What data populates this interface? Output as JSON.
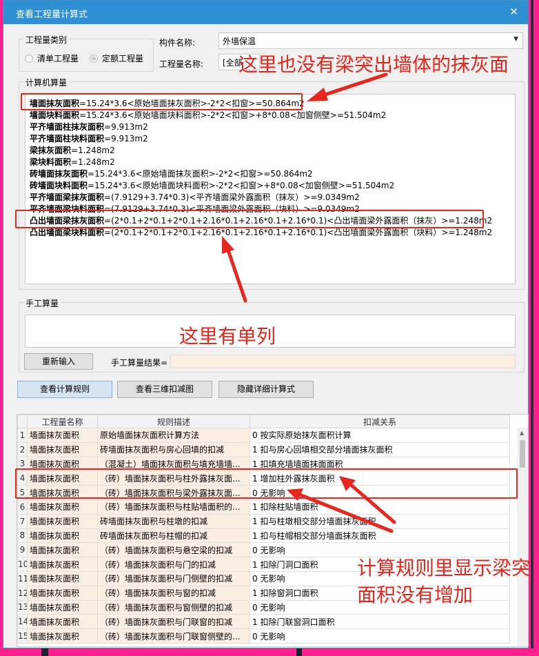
{
  "window": {
    "title": "查看工程量计算式",
    "close_glyph": "✕"
  },
  "category": {
    "legend": "工程量类别",
    "options": [
      {
        "label": "清单工程量",
        "selected": false
      },
      {
        "label": "定额工程量",
        "selected": true
      }
    ]
  },
  "component": {
    "label": "构件名称:",
    "value": "外墙保温",
    "arrow": "▼"
  },
  "quantity": {
    "label": "工程量名称:",
    "value": "[全部"
  },
  "computer": {
    "legend": "计算机算量",
    "lines": [
      {
        "name": "墙面抹灰面积",
        "formula": "=15.24*3.6<原始墙面抹灰面积>-2*2<扣窗>=50.864m2"
      },
      {
        "name": "墙面块料面积",
        "formula": "=15.24*3.6<原始墙面块料面积>-2*2<扣窗>+8*0.08<加窗侧壁>=51.504m2"
      },
      {
        "name": "平齐墙面柱抹灰面积",
        "formula": "=9.913m2"
      },
      {
        "name": "平齐墙面柱块料面积",
        "formula": "=9.913m2"
      },
      {
        "name": "梁抹灰面积",
        "formula": "=1.248m2"
      },
      {
        "name": "梁块料面积",
        "formula": "=1.248m2"
      },
      {
        "name": "砖墙面抹灰面积",
        "formula": "=15.24*3.6<原始墙面抹灰面积>-2*2<扣窗>=50.864m2"
      },
      {
        "name": "砖墙面块料面积",
        "formula": "=15.24*3.6<原始墙面块料面积>-2*2<扣窗>+8*0.08<加窗侧壁>=51.504m2"
      },
      {
        "name": "平齐墙面梁抹灰面积",
        "formula": "=(7.9129+3.74*0.3)<平齐墙面梁外露面积（抹灰）>=9.0349m2"
      },
      {
        "name": "平齐墙面梁块料面积",
        "formula": "=(7.9129+3.74*0.3)<平齐墙面梁外露面积（块料）>=9.0349m2"
      },
      {
        "name": "凸出墙面梁抹灰面积",
        "formula": "=(2*0.1+2*0.1+2*0.1+2.16*0.1+2.16*0.1+2.16*0.1)<凸出墙面梁外露面积（抹灰）>=1.248m2"
      },
      {
        "name": "凸出墙面梁块料面积",
        "formula": "=(2*0.1+2*0.1+2*0.1+2.16*0.1+2.16*0.1+2.16*0.1)<凸出墙面梁外露面积（块料）>=1.248m2"
      }
    ]
  },
  "manual": {
    "legend": "手工算量",
    "reenter_label": "重新输入",
    "result_label": "手工算量结果="
  },
  "actions": {
    "view_rules": "查看计算规则",
    "view_3d": "查看三维扣减图",
    "hide_detail": "隐藏详细计算式"
  },
  "rules_table": {
    "headers": [
      "工程量名称",
      "规则描述",
      "扣减关系"
    ],
    "rows": [
      {
        "idx": "1",
        "name": "墙面抹灰面积",
        "desc": "原始墙面抹灰面积计算方法",
        "rel": "0 按实际原始抹灰面积计算"
      },
      {
        "idx": "2",
        "name": "墙面抹灰面积",
        "desc": "砖墙面抹灰面积与房心回填的扣减",
        "rel": "1 扣与房心回填相交部分墙面抹灰面积"
      },
      {
        "idx": "3",
        "name": "墙面抹灰面积",
        "desc": "（混凝土）墙面抹灰面积与填充墙墙...",
        "rel": "1 扣填充墙墙面抹面面积"
      },
      {
        "idx": "4",
        "name": "墙面抹灰面积",
        "desc": "（砖）墙面抹灰面积与柱外露抹灰面...",
        "rel": "1 增加柱外露抹灰面积"
      },
      {
        "idx": "5",
        "name": "墙面抹灰面积",
        "desc": "（砖）墙面抹灰面积与梁外露抹灰面...",
        "rel": "0  无影响"
      },
      {
        "idx": "6",
        "name": "墙面抹灰面积",
        "desc": "（砖）墙面抹灰面积与柱贴墙面积的...",
        "rel": "1 扣除柱贴墙面积"
      },
      {
        "idx": "7",
        "name": "墙面抹灰面积",
        "desc": "砖墙面抹灰面积与柱墩的扣减",
        "rel": "1 扣与柱墩相交部分墙面抹灰面积"
      },
      {
        "idx": "8",
        "name": "墙面抹灰面积",
        "desc": "砖墙面抹灰面积与柱帽的扣减",
        "rel": "1 扣与柱帽相交部分墙面抹灰面积"
      },
      {
        "idx": "9",
        "name": "墙面抹灰面积",
        "desc": "（砖）墙面抹灰面积与悬空梁的扣减",
        "rel": "0  无影响"
      },
      {
        "idx": "10",
        "name": "墙面抹灰面积",
        "desc": "（砖）墙面抹灰面积与门的扣减",
        "rel": "1 扣除门洞口面积"
      },
      {
        "idx": "11",
        "name": "墙面抹灰面积",
        "desc": "（砖）墙面抹灰面积与门侧壁的扣减",
        "rel": "0  无影响"
      },
      {
        "idx": "12",
        "name": "墙面抹灰面积",
        "desc": "（砖）墙面抹灰面积与窗的扣减",
        "rel": "1 扣除窗洞口面积"
      },
      {
        "idx": "13",
        "name": "墙面抹灰面积",
        "desc": "（砖）墙面抹灰面积与窗侧壁的扣减",
        "rel": "0  无影响"
      },
      {
        "idx": "14",
        "name": "墙面抹灰面积",
        "desc": "（砖）墙面抹灰面积与门联窗的扣减",
        "rel": "1 扣除门联窗洞口面积"
      },
      {
        "idx": "15",
        "name": "墙面抹灰面积",
        "desc": "（砖）墙面抹灰面积与门联窗侧壁的...",
        "rel": "0  无影响"
      }
    ]
  },
  "annotations": {
    "top": "这里也没有梁突出墙体的抹灰面",
    "middle": "这里有单列",
    "bottom_line1": "计算规则里显示梁突",
    "bottom_line2": "面积没有增加"
  },
  "colors": {
    "annotation_red": "#e8261b",
    "titlebar_blue": "#2f8fd3",
    "background_pink": "#ff1f8e"
  }
}
